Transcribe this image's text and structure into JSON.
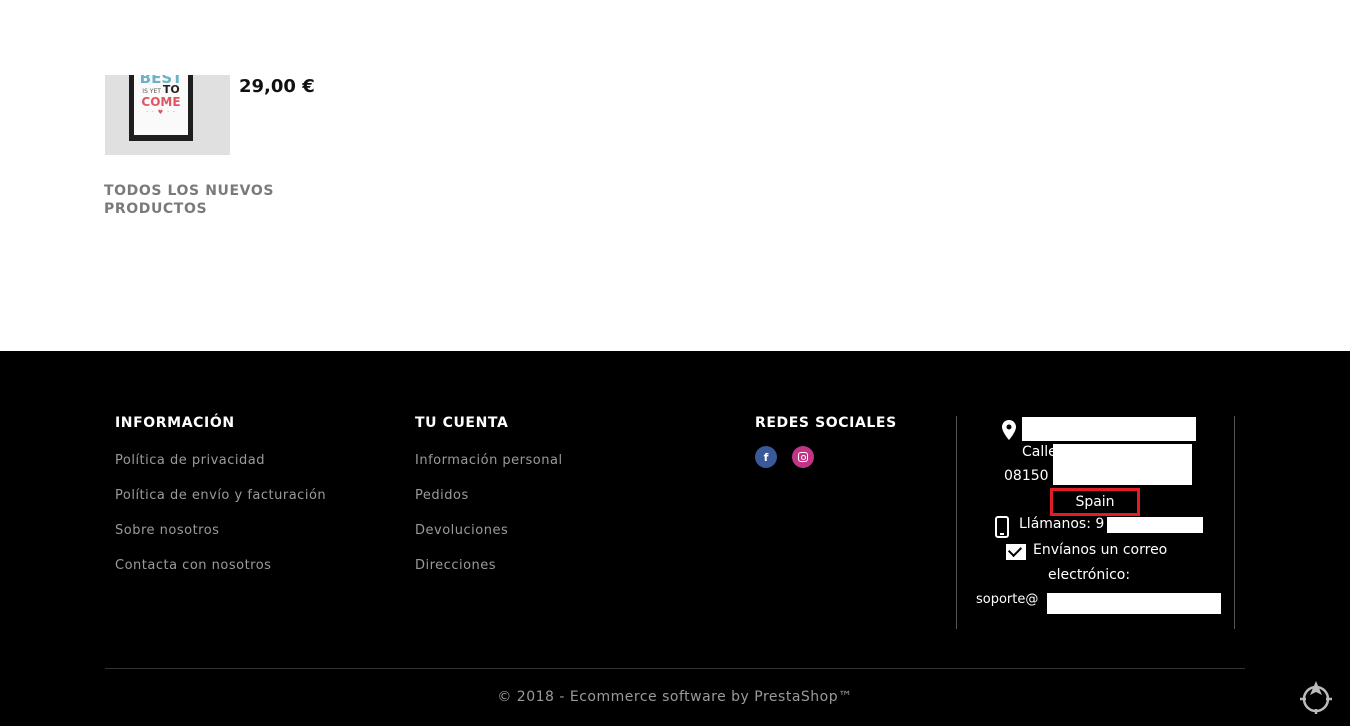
{
  "product": {
    "price": "29,00 €",
    "image_alt_lines": [
      "BEST",
      "IS YET",
      "TO",
      "COME"
    ]
  },
  "all_new_products_link": "TODOS LOS NUEVOS PRODUCTOS",
  "footer": {
    "info": {
      "heading": "INFORMACIÓN",
      "items": [
        "Política de privacidad",
        "Política de envío y facturación",
        "Sobre nosotros",
        "Contacta con nosotros"
      ]
    },
    "account": {
      "heading": "TU CUENTA",
      "items": [
        "Información personal",
        "Pedidos",
        "Devoluciones",
        "Direcciones"
      ]
    },
    "social": {
      "heading": "REDES SOCIALES",
      "icons": [
        "facebook-icon",
        "instagram-icon"
      ],
      "colors": {
        "facebook": "#3b5998",
        "instagram": "#c13584"
      }
    },
    "store": {
      "street_prefix": "Calle",
      "postal_code": "08150",
      "country": "Spain",
      "call_label": "Llámanos: 9",
      "email_label_1": "Envíanos un correo",
      "email_label_2": "electrónico:",
      "email_prefix": "soporte@",
      "highlight_color": "#e01e26"
    },
    "copyright": "© 2018 - Ecommerce software by PrestaShop™"
  }
}
